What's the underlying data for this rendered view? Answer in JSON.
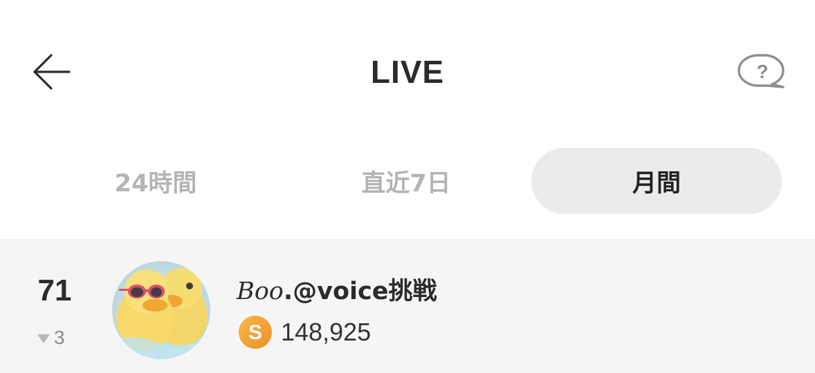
{
  "header": {
    "title": "LIVE",
    "back_icon": "arrow-left-icon",
    "help_icon": "help-bubble-icon"
  },
  "tabs": [
    {
      "label": "24時間",
      "selected": false
    },
    {
      "label": "直近7日",
      "selected": false
    },
    {
      "label": "月間",
      "selected": true
    }
  ],
  "ranking": [
    {
      "rank": "71",
      "rank_change": "3",
      "rank_change_direction": "down",
      "username_styled": "Boo",
      "username_rest": ".@voice挑戦",
      "score_icon": "s-coin-icon",
      "score": "148,925"
    }
  ],
  "colors": {
    "title": "#2b2b2b",
    "tab_inactive": "#b4b4b4",
    "tab_active_bg": "#ebebeb",
    "list_bg": "#f5f5f5",
    "coin": "#f2a23a"
  }
}
